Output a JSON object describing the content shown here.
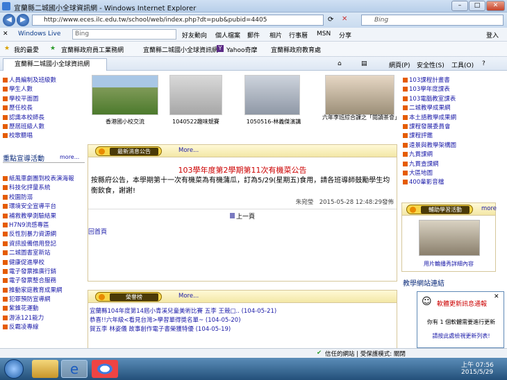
{
  "window": {
    "title": "宜蘭縣二城國小全球資訊網 - Windows Internet Explorer"
  },
  "address": {
    "url": "http://www.eces.ilc.edu.tw/school/web/index.php?dt=pub&pubid=4405",
    "search_placeholder": "Bing"
  },
  "live": {
    "brand": "Windows Live",
    "search": "Bing",
    "items": [
      "好友動向",
      "個人檔案",
      "郵件",
      "相片",
      "行事曆",
      "MSN",
      "分享"
    ],
    "signin": "登入"
  },
  "favorites": {
    "label": "我的最愛",
    "items": [
      "宜蘭縣政府員工業務網",
      "宜蘭縣二城國小全球資訊網",
      "Yahoo奇摩",
      "宜蘭縣政府教育處"
    ]
  },
  "tab": {
    "title": "宜蘭縣二城國小全球資訊網",
    "cmds": [
      "網頁(P)",
      "安全性(S)",
      "工具(O)"
    ]
  },
  "left": {
    "items_top": [
      "人員編制及班級數",
      "學生人數",
      "學校平面圖",
      "歷任校長",
      "認識本校師長",
      "歷屆班級人數",
      "校歌聽唱"
    ],
    "section_title": "重點宣導活動",
    "section_more": "more...",
    "items": [
      "紙風車劇團到校表演海報",
      "科技化評量系統",
      "校園防溺",
      "環境安全宣導平台",
      "補救教學測驗結果",
      "H7N9流感專區",
      "反性別暴力資源網",
      "資訊設備借用登記",
      "二城圖書室新站",
      "健康促進學校",
      "電子發票推廣行銷",
      "電子發票整合服務",
      "推動家庭教育成果網",
      "犯罪預防宣導網",
      "紫錐花運動",
      "游泳121能力",
      "反霸凌專線"
    ]
  },
  "photos": [
    {
      "caption": "香港國小校交流"
    },
    {
      "caption": "1040522趣味競賽"
    },
    {
      "caption": "1050516-林義傑演講"
    },
    {
      "caption": "六年李班綜合課之「閱讀茶會」"
    }
  ],
  "news": {
    "header": "最新消息公告",
    "more": "More...",
    "title": "103學年度第2學期第11次有機菜公告",
    "body": "按縣府公告，本學期第十一次有機菜為有機蒲瓜，訂為5/29(星期五)食用，請各班導師鼓勵學生均衡飲食，謝謝!",
    "meta": "朱宛瑩　2015-05-28 12:48:29發佈",
    "prev": "上一頁",
    "home": "回首頁"
  },
  "honor": {
    "header": "榮譽榜",
    "more": "More...",
    "items": [
      "宜蘭縣104年度第14屆小青溪兒童美術比賽 五李 王競□.. (104-05-21)",
      "恭喜!!六年級<看見台灣>學習單得獎名單~ (104-05-20)",
      "賀五李 林姿儀 故事創作電子書榮獲特優 (104-05-19)"
    ]
  },
  "right": {
    "items": [
      "103課程計畫書",
      "103學年度課表",
      "103電腦教室課表",
      "二城教學成果網",
      "本土語教學成果網",
      "課程發展委員會",
      "課程評鑑",
      "遠景與教學架構圖",
      "九貫課綱",
      "九貫查課網",
      "大區地圖",
      "400輩影音檔"
    ],
    "album_header": "輔助學習活動",
    "album_more": "more",
    "album_caption": "用片輪播秀詳細內容",
    "links_title": "教學網站連結"
  },
  "notice": {
    "title": "軟體更新訊息通報",
    "line1": "你有 1 個軟體需要進行更新",
    "line2": "請按此處檢視更新列表!"
  },
  "status": {
    "text": "信任的網站 | 受保護模式: 關閉"
  },
  "clock": {
    "time": "上午 07:56",
    "date": "2015/5/29"
  }
}
